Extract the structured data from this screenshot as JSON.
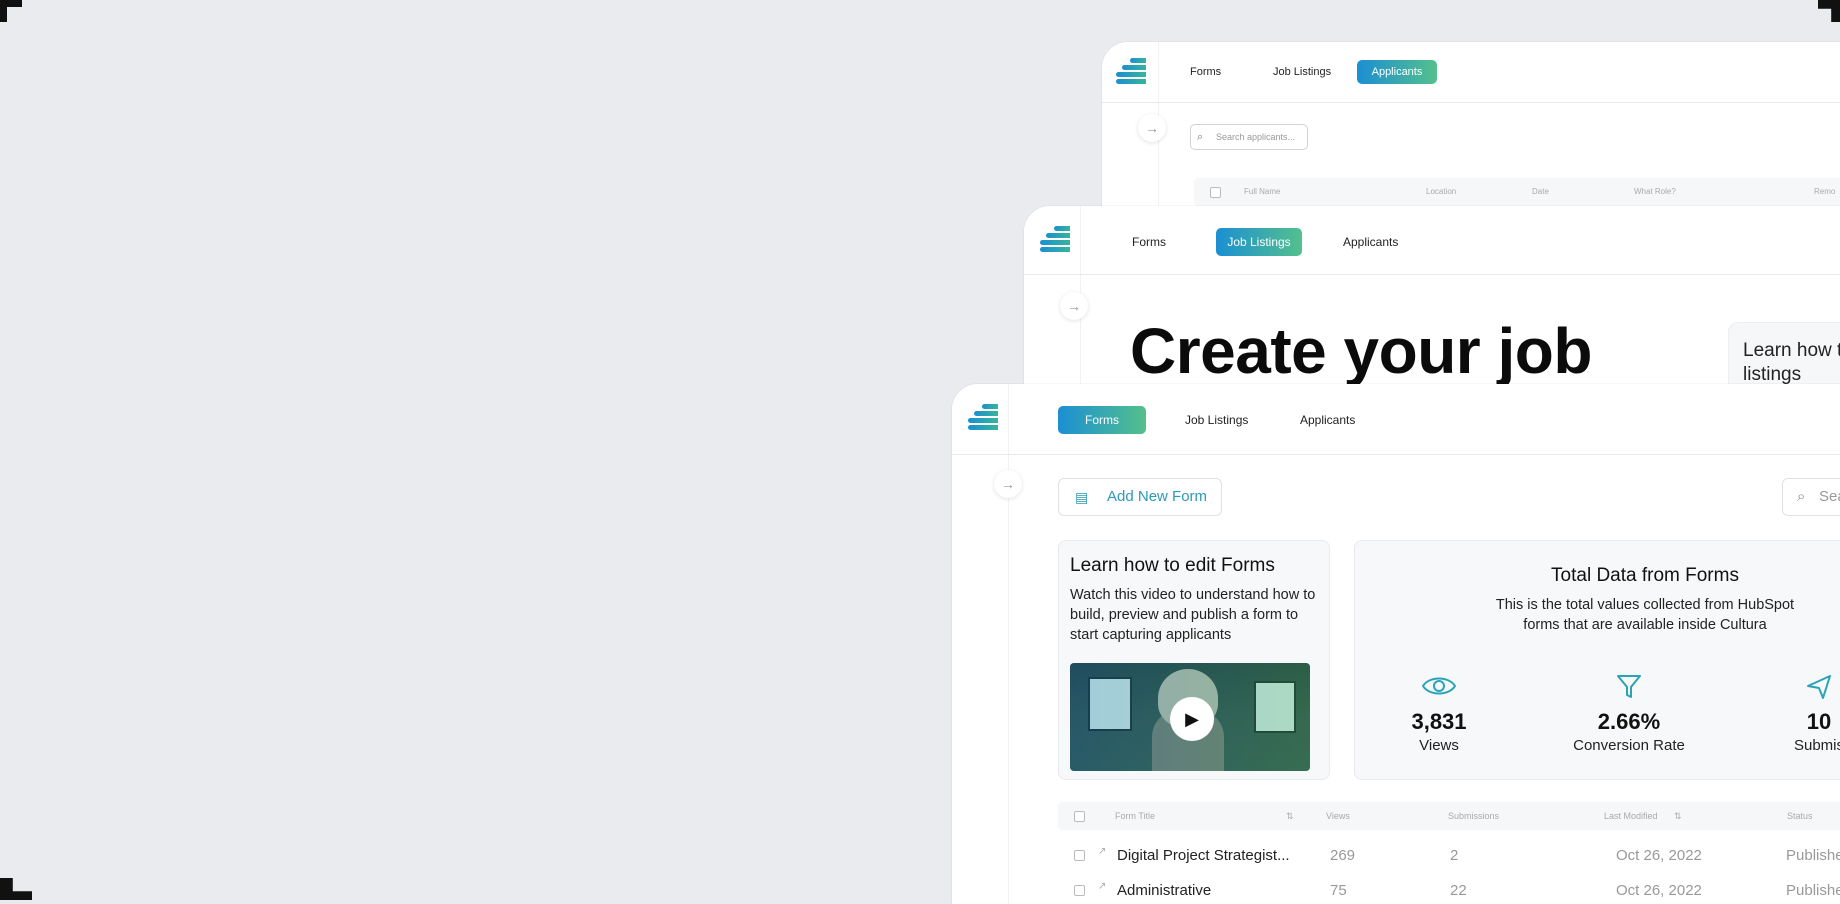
{
  "colors": {
    "background": "#e9ebee",
    "accent_from": "#1b8fd3",
    "accent_to": "#54c08c",
    "link": "#2a9ab6"
  },
  "window_applicants": {
    "nav": {
      "forms": "Forms",
      "job_listings": "Job Listings",
      "applicants": "Applicants",
      "active": "Applicants"
    },
    "search_placeholder": "Search applicants...",
    "columns": [
      "Full Name",
      "Location",
      "Date",
      "What Role?",
      "Remo"
    ]
  },
  "window_job_listings": {
    "nav": {
      "forms": "Forms",
      "job_listings": "Job Listings",
      "applicants": "Applicants",
      "active": "Job Listings"
    },
    "hero_title": "Create your job",
    "learn_card": "Learn how t listings"
  },
  "window_forms": {
    "nav": {
      "forms": "Forms",
      "job_listings": "Job Listings",
      "applicants": "Applicants",
      "active": "Forms"
    },
    "add_form_label": "Add New Form",
    "search_placeholder": "Sea",
    "edit_card": {
      "title": "Learn how to edit Forms",
      "description": "Watch this video to understand how to build, preview and publish a form to start capturing applicants"
    },
    "total_card": {
      "title": "Total Data from Forms",
      "description": "This is the total values collected from HubSpot forms that are available inside Cultura",
      "stats": [
        {
          "icon": "eye-icon",
          "value": "3,831",
          "label": "Views"
        },
        {
          "icon": "filter-icon",
          "value": "2.66%",
          "label": "Conversion Rate"
        },
        {
          "icon": "send-icon",
          "value": "10",
          "label": "Submis"
        }
      ]
    },
    "table": {
      "headers": {
        "title": "Form Title",
        "views": "Views",
        "submissions": "Submissions",
        "modified": "Last Modified",
        "status": "Status"
      },
      "rows": [
        {
          "title": "Digital Project Strategist...",
          "views": "269",
          "submissions": "2",
          "modified": "Oct 26, 2022",
          "status": "Publishe"
        },
        {
          "title": "Administrative",
          "views": "75",
          "submissions": "22",
          "modified": "Oct 26, 2022",
          "status": "Publishe"
        }
      ]
    }
  }
}
